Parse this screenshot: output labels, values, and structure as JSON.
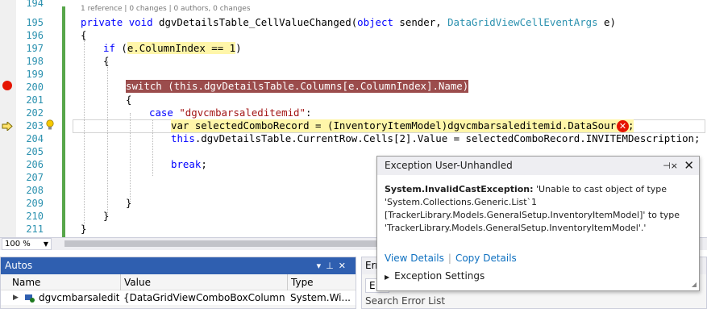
{
  "editor": {
    "code_lens": "1 reference | 0 changes | 0 authors, 0 changes",
    "line_numbers": [
      "194",
      "195",
      "196",
      "197",
      "198",
      "199",
      "200",
      "201",
      "202",
      "203",
      "204",
      "205",
      "206",
      "207",
      "208",
      "209",
      "210",
      "211"
    ],
    "lines": {
      "l194": {
        "kw1": "private",
        "kw2": "void",
        "name": " dgvDetailsTable_CellValueChanged(",
        "kw3": "object",
        "p1": " sender, ",
        "type": "DataGridViewCellEventArgs",
        "p2": " e)"
      },
      "l195": "{",
      "l196": {
        "kw": "if",
        "open": " (",
        "cond": "e.ColumnIndex == 1",
        "close": ")"
      },
      "l197": "{",
      "l199": "switch (this.dgvDetailsTable.Columns[e.ColumnIndex].Name)",
      "l200": "{",
      "l201": {
        "kw": "case",
        "str": "\"dgvcmbarsaleditemid\"",
        "rest": ":"
      },
      "l202": {
        "kw": "var",
        "p1": " selectedComboRecord = (",
        "type": "InventoryItemModel",
        "p2": ")dgvcmbarsaleditemid.DataSource;"
      },
      "l203": {
        "kw": "this",
        "rest": ".dgvDetailsTable.CurrentRow.Cells[2].Value = selectedComboRecord.INVITEMDescription;"
      },
      "l205": {
        "kw": "break",
        "rest": ";"
      },
      "l208": "}",
      "l209": "}",
      "l210": "}"
    }
  },
  "zoom": {
    "level": "100 %"
  },
  "autos": {
    "title": "Autos",
    "columns": [
      "Name",
      "Value",
      "Type"
    ],
    "row": {
      "name": "dgvcmbarsaledit...",
      "value": "{DataGridViewComboBoxColumn { ...",
      "type": "System.Wi..."
    }
  },
  "error_list": {
    "title": "Erro",
    "filter": "E",
    "search_label": "Search Error List"
  },
  "exception": {
    "title": "Exception User-Unhandled",
    "type": "System.InvalidCastException:",
    "message": " 'Unable to cast object of type 'System.Collections.Generic.List`1 [TrackerLibrary.Models.GeneralSetup.InventoryItemModel]' to type 'TrackerLibrary.Models.GeneralSetup.InventoryItemModel'.'",
    "view_details": "View Details",
    "copy_details": "Copy Details",
    "settings": "Exception Settings"
  },
  "colors": {
    "breakpoint": "#e51400",
    "breakpoint_line": "#9b4c4c",
    "current_statement": "#fff6a9",
    "tool_title_active": "#2f5fb0",
    "link": "#0e70c0",
    "change_bar": "#57a64a"
  },
  "icons": [
    "breakpoint-icon",
    "current-statement-arrow-icon",
    "lightbulb-icon",
    "error-icon",
    "pin-icon",
    "close-icon",
    "expand-icon",
    "variable-icon"
  ]
}
